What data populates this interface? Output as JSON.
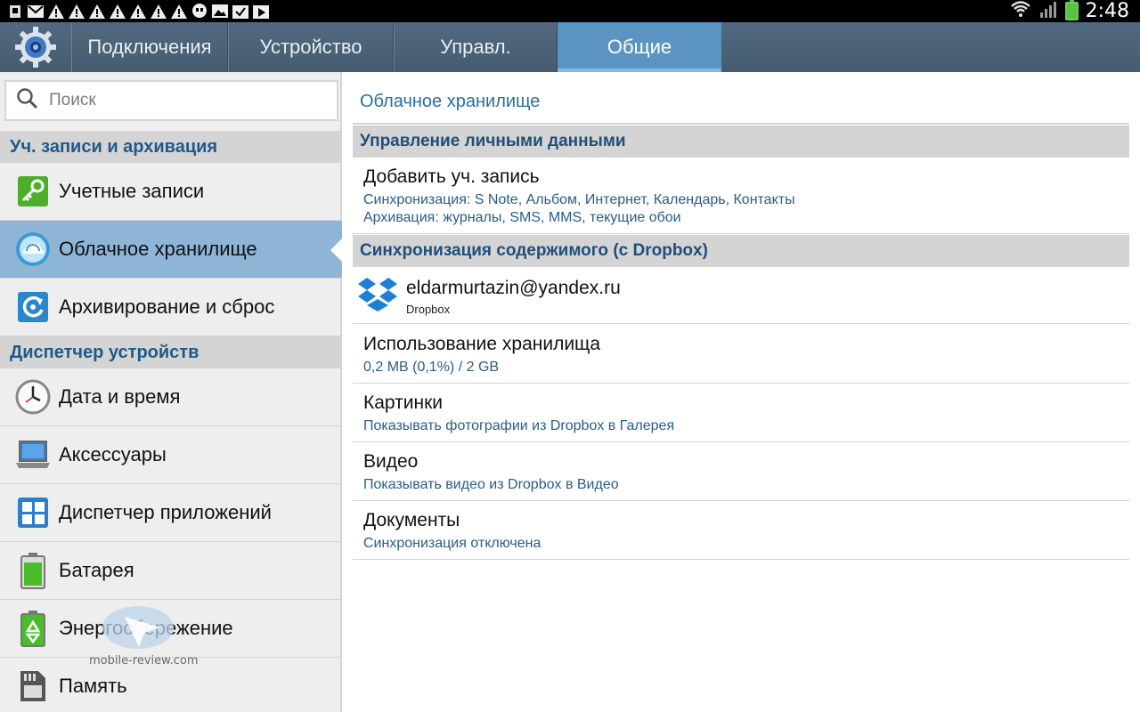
{
  "status_bar": {
    "time": "2:48",
    "notification_icons": [
      "sim-icon",
      "gmail-icon",
      "warning-icon",
      "warning-icon",
      "warning-icon",
      "warning-icon",
      "warning-icon",
      "warning-icon",
      "warning-icon",
      "hangouts-icon",
      "image-icon",
      "check-icon",
      "play-store-icon"
    ],
    "battery_color": "#5cc23a"
  },
  "tabs": [
    {
      "label": "Подключения"
    },
    {
      "label": "Устройство"
    },
    {
      "label": "Управл."
    },
    {
      "label": "Общие",
      "active": true
    }
  ],
  "sidebar": {
    "search_placeholder": "Поиск",
    "sections": [
      {
        "title": "Уч. записи и архивация"
      },
      {
        "title": "Диспетчер устройств"
      }
    ],
    "items": [
      {
        "label": "Учетные записи",
        "icon": "key-icon"
      },
      {
        "label": "Облачное хранилище",
        "icon": "cloud-icon",
        "selected": true
      },
      {
        "label": "Архивирование и сброс",
        "icon": "backup-icon"
      },
      {
        "label": "Дата и время",
        "icon": "clock-icon"
      },
      {
        "label": "Аксессуары",
        "icon": "laptop-icon"
      },
      {
        "label": "Диспетчер приложений",
        "icon": "apps-grid-icon"
      },
      {
        "label": "Батарея",
        "icon": "battery-icon"
      },
      {
        "label": "Энергосбережение",
        "icon": "eco-battery-icon"
      },
      {
        "label": "Память",
        "icon": "sd-card-icon"
      }
    ]
  },
  "content": {
    "title": "Облачное хранилище",
    "section_personal": "Управление личными данными",
    "add_account": {
      "title": "Добавить уч. запись",
      "line1": "Синхронизация: S Note, Альбом, Интернет, Календарь, Контакты",
      "line2": "Архивация: журналы, SMS, MMS, текущие обои"
    },
    "section_dropbox": "Синхронизация содержимого (с Dropbox)",
    "account": {
      "email": "eldarmurtazin@yandex.ru",
      "provider": "Dropbox"
    },
    "rows": [
      {
        "title": "Использование хранилища",
        "sub": "0,2 MB (0,1%) / 2 GB"
      },
      {
        "title": "Картинки",
        "sub": "Показывать фотографии из Dropbox в Галерея"
      },
      {
        "title": "Видео",
        "sub": "Показывать видео из Dropbox в Видео"
      },
      {
        "title": "Документы",
        "sub": "Синхронизация отключена"
      }
    ]
  },
  "watermark": {
    "text": "mobile-review.com"
  },
  "colors": {
    "tabbar": "#4b6176",
    "active_tab": "#5b94c3",
    "selected_item": "#8fb5d6",
    "section_text": "#1f5a8a",
    "link_text": "#2670a6"
  }
}
